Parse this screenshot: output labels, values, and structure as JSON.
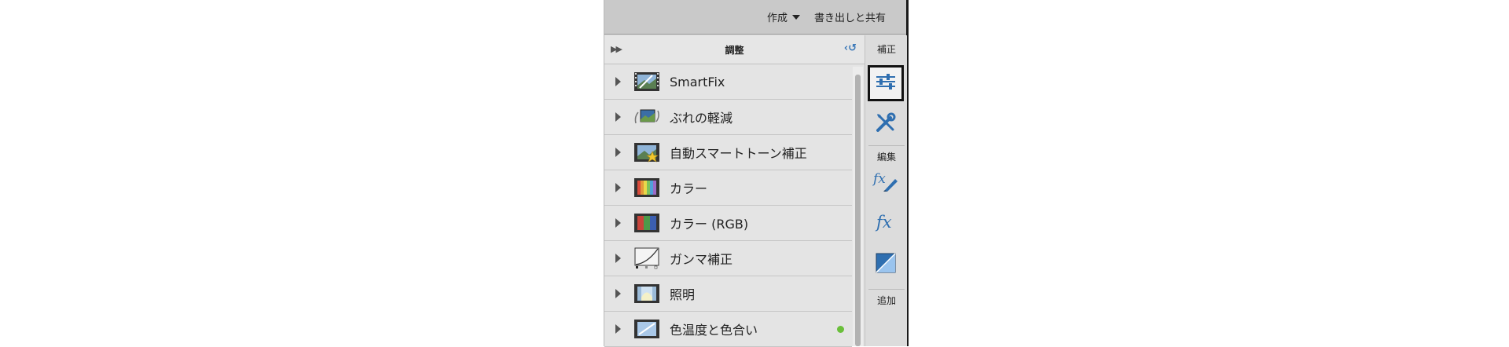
{
  "topbar": {
    "create_label": "作成",
    "share_label": "書き出しと共有"
  },
  "panel": {
    "title": "調整",
    "items": [
      {
        "label": "SmartFix",
        "icon": "smartfix-icon",
        "arrow": "expand"
      },
      {
        "label": "ぶれの軽減",
        "icon": "shake-reduction-icon",
        "arrow": "expand"
      },
      {
        "label": "自動スマートトーン補正",
        "icon": "auto-smart-tone-icon",
        "arrow": "expand"
      },
      {
        "label": "カラー",
        "icon": "color-icon",
        "arrow": "expand"
      },
      {
        "label": "カラー (RGB)",
        "icon": "color-rgb-icon",
        "arrow": "expand"
      },
      {
        "label": "ガンマ補正",
        "icon": "gamma-curve-icon",
        "arrow": "expand"
      },
      {
        "label": "照明",
        "icon": "lighting-icon",
        "arrow": "expand"
      },
      {
        "label": "色温度と色合い",
        "icon": "temperature-tint-icon",
        "arrow": "expand",
        "status_dot_color": "#6abf3b"
      }
    ]
  },
  "toolbar": {
    "section_correct": "補正",
    "section_edit": "編集",
    "section_add": "追加",
    "buttons": [
      {
        "name": "adjustments-sliders-icon",
        "active": true
      },
      {
        "name": "tools-wrench-icon",
        "active": false
      },
      {
        "name": "fx-brush-icon",
        "active": false
      },
      {
        "name": "fx-icon",
        "active": false
      },
      {
        "name": "gradient-square-icon",
        "active": false
      }
    ]
  },
  "colors": {
    "accent_blue": "#3a78b8",
    "status_green": "#6abf3b",
    "panel_bg": "#e4e4e4"
  }
}
